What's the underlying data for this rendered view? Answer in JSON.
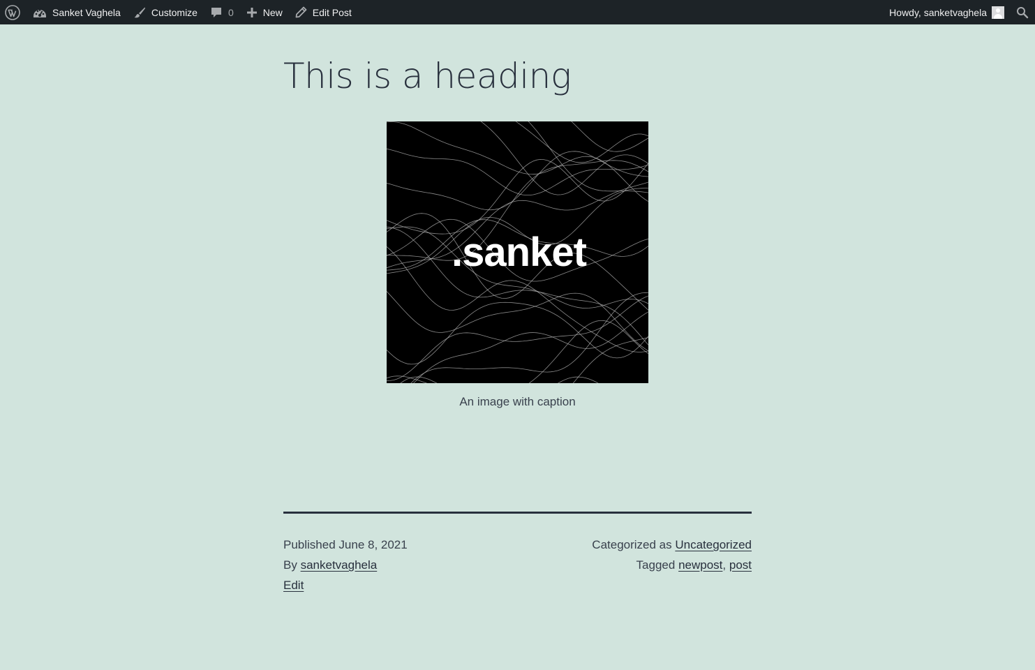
{
  "admin_bar": {
    "site_name": "Sanket Vaghela",
    "customize_label": "Customize",
    "comments_count": "0",
    "new_label": "New",
    "edit_post_label": "Edit Post",
    "howdy_text": "Howdy, sanketvaghela",
    "icons": [
      "wordpress-logo-icon",
      "dashboard-icon",
      "brush-icon",
      "comment-icon",
      "plus-icon",
      "pencil-icon",
      "avatar",
      "search-icon"
    ]
  },
  "post": {
    "title": "This is a heading",
    "image_logo_text": ".sanket",
    "caption": "An image with caption"
  },
  "footer_meta": {
    "published_prefix": "Published",
    "published_date": "June 8, 2021",
    "by_prefix": "By",
    "author": "sanketvaghela",
    "edit_label": "Edit",
    "categorized_prefix": "Categorized as",
    "category": "Uncategorized",
    "tagged_prefix": "Tagged",
    "tags": [
      "newpost",
      "post"
    ],
    "tag_separator": ","
  },
  "colors": {
    "background": "#d1e4dd",
    "text": "#28303d",
    "admin_bar": "#1d2327"
  }
}
